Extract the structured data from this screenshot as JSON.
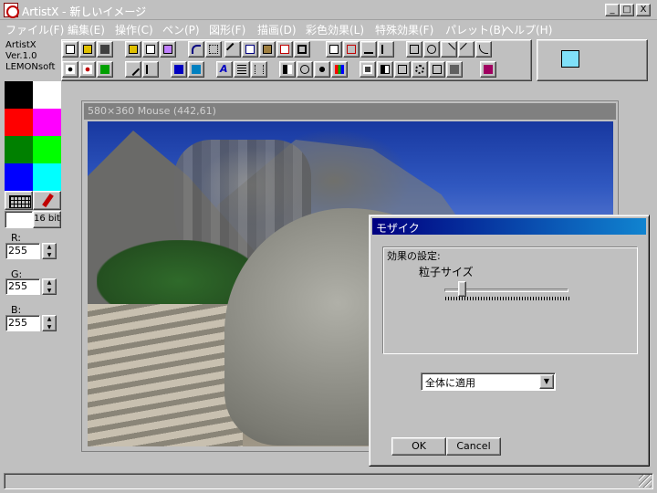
{
  "window": {
    "title": "ArtistX - 新しいイメージ",
    "minimize": "_",
    "maximize": "□",
    "close": "X"
  },
  "menu": [
    {
      "label": "ファイル(F)"
    },
    {
      "label": "編集(E)"
    },
    {
      "label": "操作(C)"
    },
    {
      "label": "ペン(P)"
    },
    {
      "label": "図形(F)"
    },
    {
      "label": "描画(D)"
    },
    {
      "label": "彩色効果(L)"
    },
    {
      "label": "特殊効果(F)"
    },
    {
      "label": "パレット(B)"
    },
    {
      "label": "ヘルプ(H)"
    }
  ],
  "app_info": {
    "name": "ArtistX",
    "version": "Ver.1.0",
    "vendor": "LEMONsoft"
  },
  "palette": [
    "#000000",
    "#ffffff",
    "#ff0000",
    "#ff00ff",
    "#008000",
    "#00ff00",
    "#0000ff",
    "#00ffff"
  ],
  "color_panel": {
    "bit_label": "16 bit",
    "r_label": "R:",
    "r_value": "255",
    "g_label": "G:",
    "g_value": "255",
    "b_label": "B:",
    "b_value": "255",
    "current_color": "#80e0f8"
  },
  "image_window": {
    "status": "580×360 Mouse (442,61)"
  },
  "dialog": {
    "title": "モザイク",
    "group_label": "効果の設定:",
    "particle_label": "粒子サイズ",
    "slider_value": 0.12,
    "apply_option": "全体に適用",
    "ok": "OK",
    "cancel": "Cancel"
  }
}
